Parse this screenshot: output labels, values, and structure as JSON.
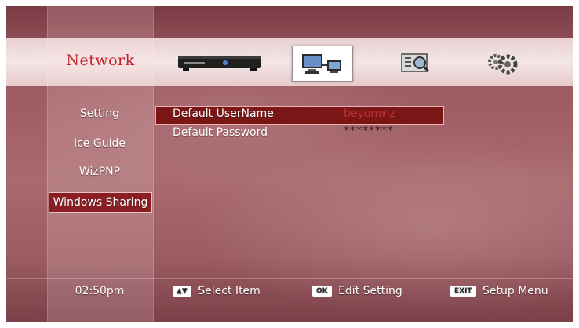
{
  "header": {
    "title": "Network"
  },
  "icons": [
    {
      "name": "set-top-box-icon",
      "active": false
    },
    {
      "name": "network-computers-icon",
      "active": true
    },
    {
      "name": "media-search-icon",
      "active": false
    },
    {
      "name": "settings-gears-icon",
      "active": false
    }
  ],
  "sidebar": {
    "items": [
      {
        "label": "Setting"
      },
      {
        "label": "Ice Guide"
      },
      {
        "label": "WizPNP"
      },
      {
        "label": "Windows Sharing",
        "selected": true
      }
    ]
  },
  "fields": [
    {
      "label": "Default UserName",
      "value": "beyonwiz",
      "selected": true
    },
    {
      "label": "Default Password",
      "value": "********"
    }
  ],
  "footer": {
    "time": "02:50pm",
    "hints": [
      {
        "key": "▲▼",
        "label": "Select Item"
      },
      {
        "key": "OK",
        "label": "Edit Setting"
      },
      {
        "key": "EXIT",
        "label": "Setup Menu"
      }
    ]
  },
  "colors": {
    "accent": "#c8202a",
    "selection": "#7a1616",
    "value_selected": "#c23030",
    "value": "#2b1a1a"
  }
}
